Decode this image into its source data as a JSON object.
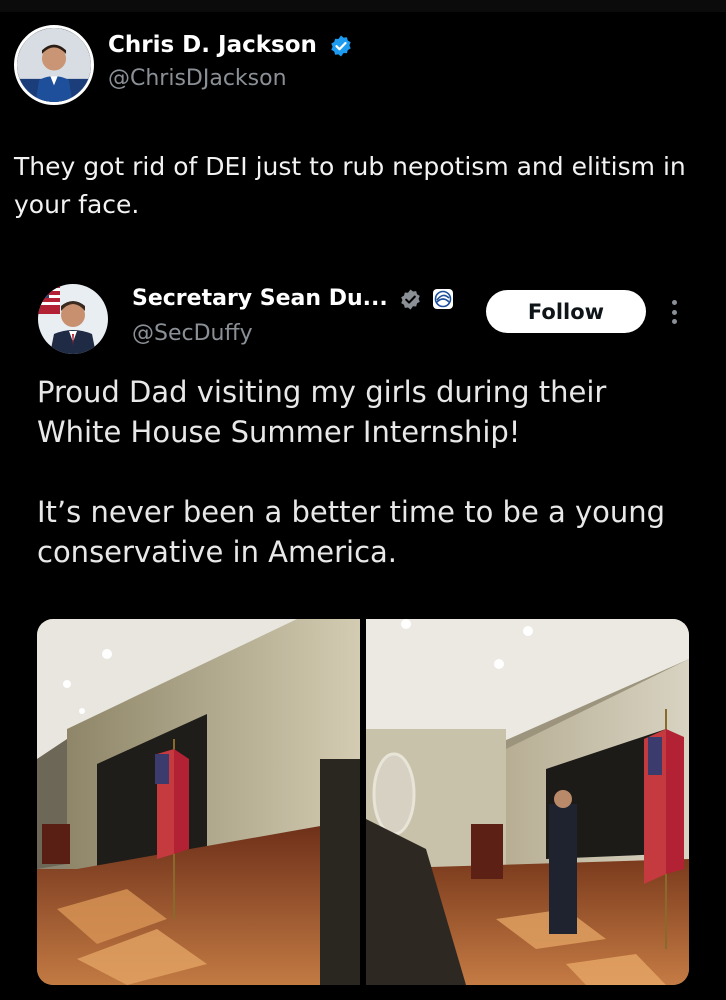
{
  "tweet": {
    "author_name": "Chris D. Jackson",
    "author_handle": "@ChrisDJackson",
    "text": "They got rid of DEI just to rub nepotism and elitism in your face.",
    "verified_icon": "verified-badge-icon"
  },
  "quoted_tweet": {
    "author_name": "Secretary Sean Du...",
    "author_handle": "@SecDuffy",
    "follow_label": "Follow",
    "badges": [
      "verified-badge-icon",
      "dot-affiliate-icon"
    ],
    "paragraphs": [
      "Proud Dad visiting my girls during their White House Summer Internship!",
      "It’s never been a better time to be a young conservative in America."
    ],
    "media": [
      {
        "description": "photo-room-with-podium-and-flag-left"
      },
      {
        "description": "photo-room-with-audience-and-flag-right"
      }
    ]
  },
  "colors": {
    "background": "#000000",
    "verified_blue": "#1d9bf0",
    "handle_gray": "#8b9096",
    "follow_bg": "#ffffff"
  }
}
